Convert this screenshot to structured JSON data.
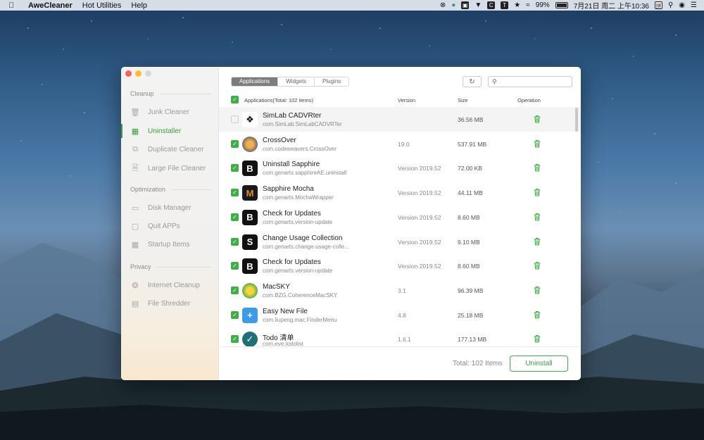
{
  "menubar": {
    "app_name": "AweCleaner",
    "items": [
      "Hot Utilities",
      "Help"
    ],
    "battery": "99%",
    "clock": "7月21日 周二 上午10:36",
    "input_method": "拼"
  },
  "sidebar": {
    "sections": [
      {
        "title": "Cleanup",
        "items": [
          "Junk Cleaner",
          "Uninstaller",
          "Duplicate Cleaner",
          "Large File Cleaner"
        ]
      },
      {
        "title": "Optimization",
        "items": [
          "Disk Manager",
          "Quit APPs",
          "Startup Items"
        ]
      },
      {
        "title": "Privacy",
        "items": [
          "Internet Cleanup",
          "File Shredder"
        ]
      }
    ],
    "active": "Uninstaller"
  },
  "tabs": [
    "Applications",
    "Widgets",
    "Plugins"
  ],
  "active_tab": "Applications",
  "search": {
    "placeholder": "",
    "value": ""
  },
  "table": {
    "headers": {
      "applications": "Applications(Total: 102 items)",
      "version": "Version",
      "size": "Size",
      "operation": "Operation"
    },
    "rows": [
      {
        "name": "SimLab CADVRter",
        "bundle_id": "com.SimLab.SimLabCADVRTer",
        "version": "",
        "size": "36.56 MB",
        "checked": false,
        "icon": "simlab-icon"
      },
      {
        "name": "CrossOver",
        "bundle_id": "com.codeweavers.CrossOver",
        "version": "19.0",
        "size": "537.91 MB",
        "checked": true,
        "icon": "crossover-icon"
      },
      {
        "name": "Uninstall Sapphire",
        "bundle_id": "com.genarts.sapphireAE.uninstall",
        "version": "Version 2019.52",
        "size": "72.00 KB",
        "checked": true,
        "icon": "sapphire-b-icon"
      },
      {
        "name": "Sapphire Mocha",
        "bundle_id": "com.genarts.MochaWrapper",
        "version": "Version 2019.52",
        "size": "44.11 MB",
        "checked": true,
        "icon": "mocha-m-icon"
      },
      {
        "name": "Check for Updates",
        "bundle_id": "com.genarts.version-update",
        "version": "Version 2019.52",
        "size": "8.60 MB",
        "checked": true,
        "icon": "sapphire-b-icon"
      },
      {
        "name": "Change Usage Collection",
        "bundle_id": "com.genarts.change-usage-colle…",
        "version": "Version 2019.52",
        "size": "9.10 MB",
        "checked": true,
        "icon": "sapphire-s-icon"
      },
      {
        "name": "Check for Updates",
        "bundle_id": "com.genarts.version-update",
        "version": "Version 2019.52",
        "size": "8.60 MB",
        "checked": true,
        "icon": "sapphire-b-icon"
      },
      {
        "name": "MacSKY",
        "bundle_id": "com.BZG.CoherenceMacSKY",
        "version": "3.1",
        "size": "96.39 MB",
        "checked": true,
        "icon": "macsky-icon"
      },
      {
        "name": "Easy New File",
        "bundle_id": "com.liupeng.mac.FinderMenu",
        "version": "4.8",
        "size": "25.18 MB",
        "checked": true,
        "icon": "folder-plus-icon"
      },
      {
        "name": "Todo 清单",
        "bundle_id": "com.eve.todolist",
        "version": "1.6.1",
        "size": "177.13 MB",
        "checked": true,
        "icon": "todo-icon"
      }
    ]
  },
  "footer": {
    "total": "Total: 102 Items",
    "uninstall_label": "Uninstall"
  },
  "colors": {
    "accent": "#3fae48",
    "active_text": "#3a9d45",
    "tab_active": "#7d7d7d"
  }
}
